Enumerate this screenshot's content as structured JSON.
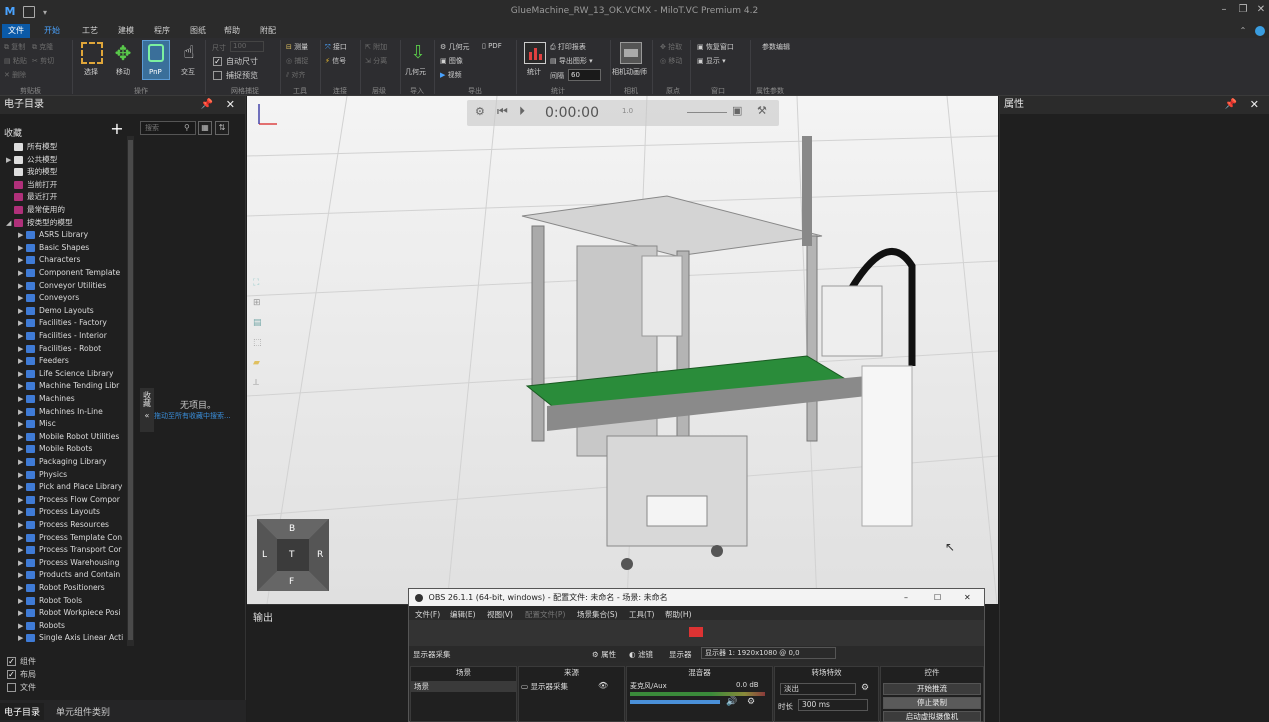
{
  "window": {
    "title": "GlueMachine_RW_13_OK.VCMX - MiloT.VC Premium 4.2",
    "logo": "M"
  },
  "menu": {
    "tabs": [
      "文件",
      "开始",
      "工艺",
      "建模",
      "程序",
      "图纸",
      "帮助",
      "附配"
    ]
  },
  "ribbon": {
    "clipboard": {
      "group": "剪贴板",
      "copy": "复制",
      "paste": "粘贴",
      "delete": "删除",
      "clone": "克隆",
      "cut": "剪切"
    },
    "manipulate": {
      "group": "操作",
      "select": "选择",
      "move": "移动",
      "pnp": "PnP",
      "interact": "交互"
    },
    "grid": {
      "group": "网格捕捉",
      "size_label": "尺寸",
      "size_value": "100",
      "auto_size": "自动尺寸",
      "snap": "捕捉预览"
    },
    "tools": {
      "group": "工具",
      "measure": "测量",
      "snap": "捕捉",
      "align": "对齐"
    },
    "connect": {
      "group": "连接",
      "interface": "接口",
      "signal": "信号"
    },
    "hierarchy": {
      "group": "层级",
      "attach": "附加",
      "detach": "分离"
    },
    "import": {
      "group": "导入",
      "geometry": "几何元"
    },
    "export": {
      "group": "导出",
      "geometry": "几何元",
      "pdf": "PDF",
      "image": "图像",
      "video": "视频"
    },
    "statistics": {
      "group": "统计",
      "stats": "统计",
      "print_report": "打印报表",
      "export_graph": "导出图形",
      "interval_label": "间隔",
      "interval_value": "60"
    },
    "camera": {
      "group": "相机",
      "camera_anim": "相机动画师"
    },
    "points": {
      "group": "原点",
      "pick": "拾取",
      "move": "移动"
    },
    "window": {
      "group": "窗口",
      "restore": "恢复窗口",
      "show": "显示"
    },
    "params": {
      "group": "属性参数",
      "param_edit": "参数编辑"
    }
  },
  "left_panel": {
    "title": "电子目录",
    "favorites": "收藏",
    "search_placeholder": "搜索",
    "no_items": "无项目。",
    "no_items_hint": "拖动至所有收藏中搜索...",
    "collapse_label": "收藏",
    "tree": [
      {
        "label": "所有模型",
        "icon": "white",
        "arrow": ""
      },
      {
        "label": "公共模型",
        "icon": "white",
        "arrow": "▶"
      },
      {
        "label": "我的模型",
        "icon": "white",
        "arrow": ""
      },
      {
        "label": "当前打开",
        "icon": "pink",
        "arrow": ""
      },
      {
        "label": "最近打开",
        "icon": "pink",
        "arrow": ""
      },
      {
        "label": "最常使用的",
        "icon": "pink",
        "arrow": ""
      },
      {
        "label": "按类型的模型",
        "icon": "pink",
        "arrow": "◢"
      },
      {
        "label": "ASRS Library",
        "icon": "blue",
        "arrow": "▶"
      },
      {
        "label": "Basic Shapes",
        "icon": "blue",
        "arrow": "▶"
      },
      {
        "label": "Characters",
        "icon": "blue",
        "arrow": "▶"
      },
      {
        "label": "Component Template",
        "icon": "blue",
        "arrow": "▶"
      },
      {
        "label": "Conveyor Utilities",
        "icon": "blue",
        "arrow": "▶"
      },
      {
        "label": "Conveyors",
        "icon": "blue",
        "arrow": "▶"
      },
      {
        "label": "Demo Layouts",
        "icon": "blue",
        "arrow": "▶"
      },
      {
        "label": "Facilities - Factory",
        "icon": "blue",
        "arrow": "▶"
      },
      {
        "label": "Facilities - Interior",
        "icon": "blue",
        "arrow": "▶"
      },
      {
        "label": "Facilities - Robot",
        "icon": "blue",
        "arrow": "▶"
      },
      {
        "label": "Feeders",
        "icon": "blue",
        "arrow": "▶"
      },
      {
        "label": "Life Science Library",
        "icon": "blue",
        "arrow": "▶"
      },
      {
        "label": "Machine Tending Libr",
        "icon": "blue",
        "arrow": "▶"
      },
      {
        "label": "Machines",
        "icon": "blue",
        "arrow": "▶"
      },
      {
        "label": "Machines In-Line",
        "icon": "blue",
        "arrow": "▶"
      },
      {
        "label": "Misc",
        "icon": "blue",
        "arrow": "▶"
      },
      {
        "label": "Mobile Robot Utilities",
        "icon": "blue",
        "arrow": "▶"
      },
      {
        "label": "Mobile Robots",
        "icon": "blue",
        "arrow": "▶"
      },
      {
        "label": "Packaging Library",
        "icon": "blue",
        "arrow": "▶"
      },
      {
        "label": "Physics",
        "icon": "blue",
        "arrow": "▶"
      },
      {
        "label": "Pick and Place Library",
        "icon": "blue",
        "arrow": "▶"
      },
      {
        "label": "Process Flow Compor",
        "icon": "blue",
        "arrow": "▶"
      },
      {
        "label": "Process Layouts",
        "icon": "blue",
        "arrow": "▶"
      },
      {
        "label": "Process Resources",
        "icon": "blue",
        "arrow": "▶"
      },
      {
        "label": "Process Template Con",
        "icon": "blue",
        "arrow": "▶"
      },
      {
        "label": "Process Transport Cor",
        "icon": "blue",
        "arrow": "▶"
      },
      {
        "label": "Process Warehousing",
        "icon": "blue",
        "arrow": "▶"
      },
      {
        "label": "Products and Contain",
        "icon": "blue",
        "arrow": "▶"
      },
      {
        "label": "Robot Positioners",
        "icon": "blue",
        "arrow": "▶"
      },
      {
        "label": "Robot Tools",
        "icon": "blue",
        "arrow": "▶"
      },
      {
        "label": "Robot Workpiece Posi",
        "icon": "blue",
        "arrow": "▶"
      },
      {
        "label": "Robots",
        "icon": "blue",
        "arrow": "▶"
      },
      {
        "label": "Single Axis Linear Acti",
        "icon": "blue",
        "arrow": "▶"
      }
    ],
    "checks": [
      {
        "label": "组件",
        "checked": true
      },
      {
        "label": "布局",
        "checked": true
      },
      {
        "label": "文件",
        "checked": false
      }
    ],
    "tabs": [
      "电子目录",
      "单元组件类别"
    ]
  },
  "viewport": {
    "time": "0:00:00",
    "speed": "1.0",
    "navcube": {
      "top": "B",
      "left": "L",
      "center": "T",
      "right": "R",
      "bottom": "F"
    }
  },
  "output_panel": {
    "title": "输出"
  },
  "right_panel": {
    "title": "属性"
  },
  "obs": {
    "title": "OBS 26.1.1 (64-bit, windows) - 配置文件: 未命名 - 场景: 未命名",
    "menu": [
      "文件(F)",
      "编辑(E)",
      "视图(V)",
      "配置文件(P)",
      "场景集合(S)",
      "工具(T)",
      "帮助(H)"
    ],
    "source_bar": {
      "source": "显示器采集",
      "props": "属性",
      "filters": "滤镜",
      "display_label": "显示器",
      "display_value": "显示器 1: 1920x1080 @ 0,0"
    },
    "columns": {
      "scenes": "场景",
      "sources": "来源",
      "mixer": "混音器",
      "transitions": "转场特效",
      "controls": "控件"
    },
    "scene_item": "场景",
    "source_item": "显示器采集",
    "mixer_item": "麦克风/Aux",
    "mixer_db": "0.0 dB",
    "transition_value": "淡出",
    "duration_label": "时长",
    "duration_value": "300 ms",
    "buttons": {
      "start_stream": "开始推流",
      "stop_record": "停止录制",
      "virtual_cam": "启动虚拟摄像机"
    }
  }
}
